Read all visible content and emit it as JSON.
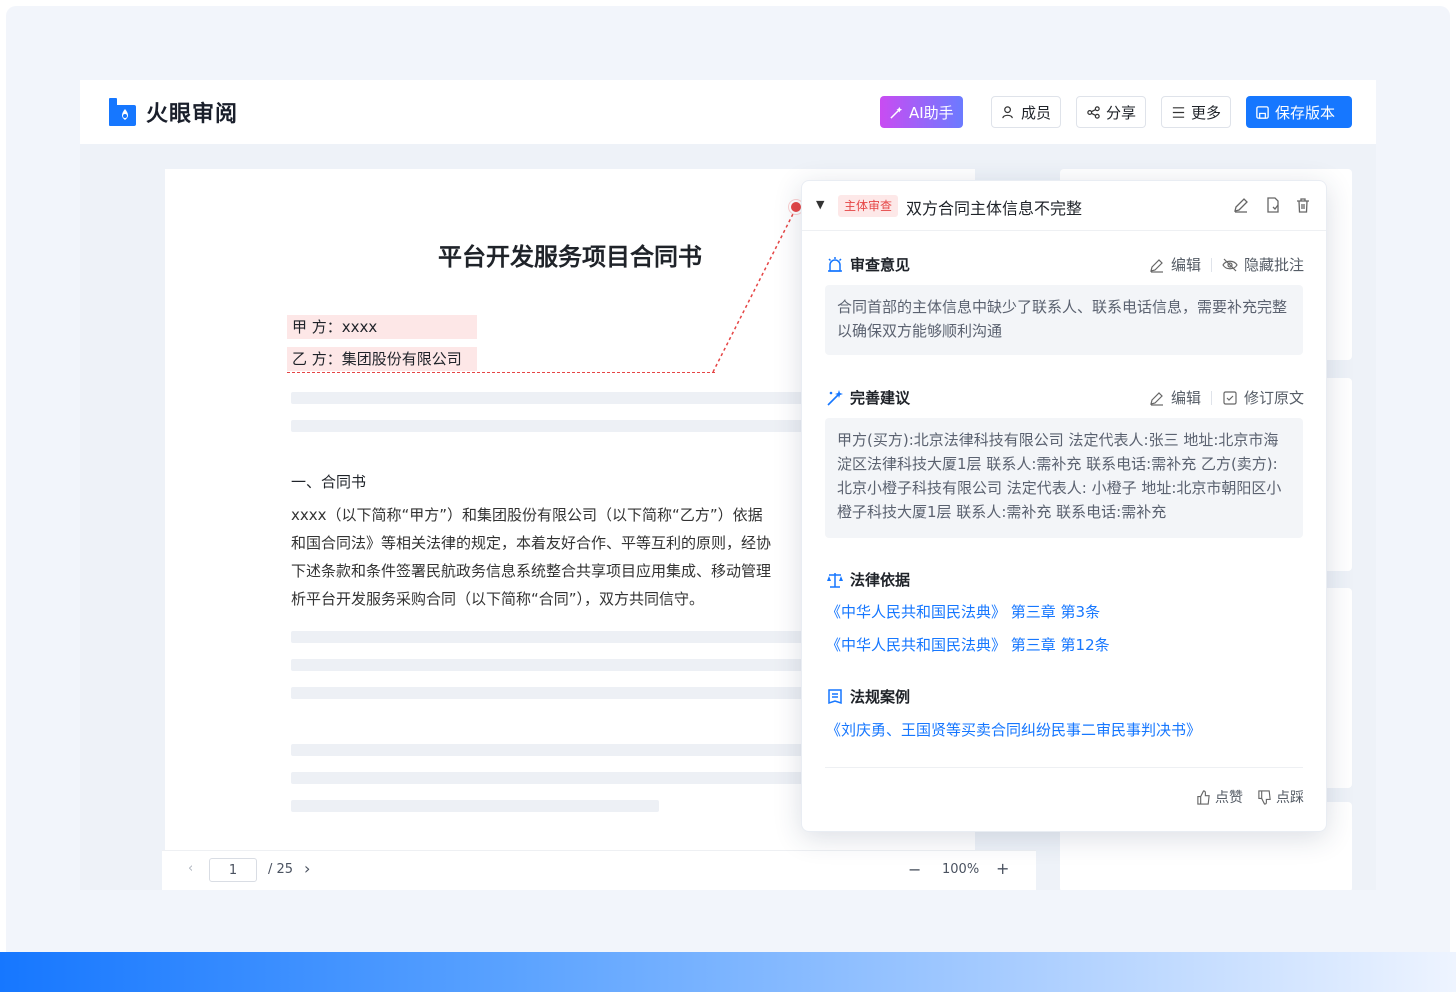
{
  "app": {
    "name": "火眼审阅"
  },
  "header": {
    "ai_label": "AI助手",
    "members_label": "成员",
    "share_label": "分享",
    "more_label": "更多",
    "save_label": "保存版本"
  },
  "document": {
    "title": "平台开发服务项目合同书",
    "party_a": "甲 方：xxxx",
    "party_b": "乙 方：集团股份有限公司",
    "section_heading": "一、合同书",
    "paragraph_lines": [
      "xxxx（以下简称“甲方”）和集团股份有限公司（以下简称“乙方”）依据",
      "和国合同法》等相关法律的规定，本着友好合作、平等互利的原则，经协",
      "下述条款和条件签署民航政务信息系统整合共享项目应用集成、移动管理",
      "析平台开发服务采购合同（以下简称“合同”），双方共同信守。"
    ]
  },
  "pager": {
    "current_page": "1",
    "total": "/ 25",
    "zoom": "100%"
  },
  "review_panel": {
    "tag": "主体审查",
    "title": "双方合同主体信息不完整",
    "opinion": {
      "label": "审查意见",
      "edit_label": "编辑",
      "hide_label": "隐藏批注",
      "text": "合同首部的主体信息中缺少了联系人、联系电话信息，需要补充完整以确保双方能够顺利沟通"
    },
    "suggestion": {
      "label": "完善建议",
      "edit_label": "编辑",
      "revise_label": "修订原文",
      "text": "甲方(买方):北京法律科技有限公司 法定代表人:张三 地址:北京市海淀区法律科技大厦1层 联系人:需补充 联系电话:需补充 乙方(卖方):北京小橙子科技有限公司 法定代表人: 小橙子 地址:北京市朝阳区小橙子科技大厦1层 联系人:需补充 联系电话:需补充"
    },
    "legal_basis": {
      "label": "法律依据",
      "links": [
        "《中华人民共和国民法典》 第三章 第3条",
        "《中华人民共和国民法典》 第三章 第12条"
      ]
    },
    "cases": {
      "label": "法规案例",
      "links": [
        "《刘庆勇、王国贤等买卖合同纠纷民事二审民事判决书》"
      ]
    },
    "like_label": "点赞",
    "dislike_label": "点踩"
  },
  "colors": {
    "primary": "#1677ff",
    "highlight": "#fde7e7",
    "danger": "#e54545"
  }
}
